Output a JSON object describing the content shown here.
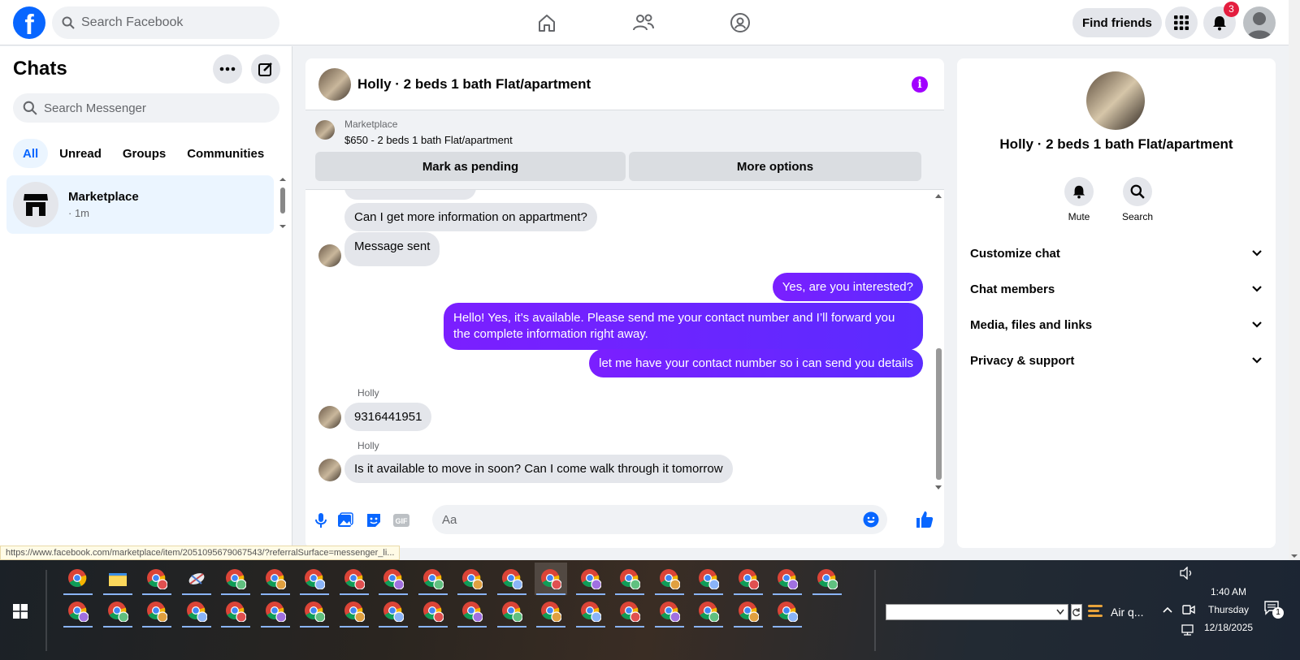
{
  "topbar": {
    "search_placeholder": "Search Facebook",
    "find_friends": "Find friends",
    "notification_count": "3",
    "logo_letter": "f"
  },
  "chats": {
    "title": "Chats",
    "search_placeholder": "Search Messenger",
    "filters": [
      "All",
      "Unread",
      "Groups",
      "Communities"
    ],
    "items": [
      {
        "name": "Marketplace",
        "time": "· 1m"
      }
    ]
  },
  "conversation": {
    "title": "Holly · 2 beds 1 bath Flat/apartment",
    "listing": {
      "source": "Marketplace",
      "price_title": "$650 - 2 beds 1 bath Flat/apartment",
      "mark_pending": "Mark as pending",
      "more_options": "More options"
    },
    "messages": [
      {
        "from": "holly",
        "text": "Can I get more information on appartment?"
      },
      {
        "from": "holly",
        "text": "Message sent"
      },
      {
        "from": "me",
        "text": "Yes, are you interested?"
      },
      {
        "from": "me",
        "text": "Hello! Yes, it’s available. Please send me your contact number and I’ll forward you the complete information right away."
      },
      {
        "from": "me",
        "text": "let me have your contact number so i can send you details"
      },
      {
        "from": "holly",
        "sender": "Holly",
        "text": "9316441951"
      },
      {
        "from": "holly",
        "sender": "Holly",
        "text": "Is it available to move in soon? Can I come walk through it tomorrow"
      }
    ],
    "composer_placeholder": "Aa"
  },
  "details": {
    "title": "Holly · 2 beds 1 bath Flat/apartment",
    "actions": [
      "Mute",
      "Search"
    ],
    "sections": [
      "Customize chat",
      "Chat members",
      "Media, files and links",
      "Privacy & support"
    ]
  },
  "status_url": "https://www.facebook.com/marketplace/item/2051095679067543/?referralSurface=messenger_li...",
  "taskbar": {
    "weather": "Air q...",
    "time": "1:40 AM",
    "day": "Thursday",
    "date": "12/18/2025",
    "notification_count": "1"
  },
  "colors": {
    "facebook_blue": "#0866ff",
    "outgoing_bubble": "#6a24ff",
    "incoming_bubble": "#e4e6eb",
    "badge_red": "#e41e3f"
  }
}
